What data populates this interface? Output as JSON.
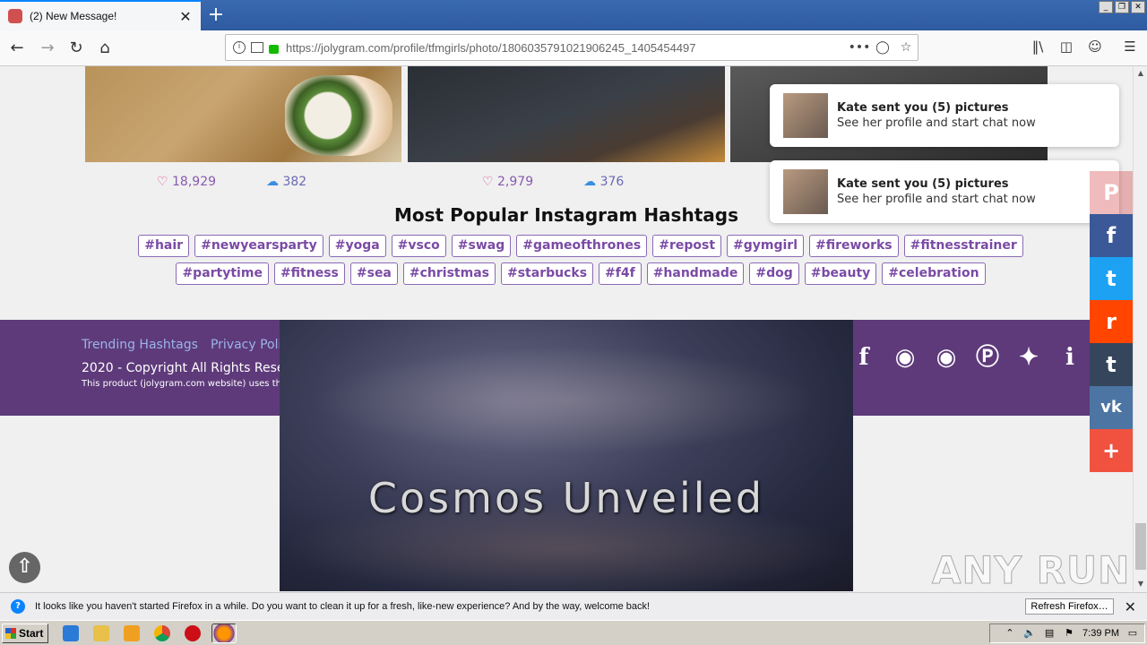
{
  "browser": {
    "tab_title": "(2) New Message!",
    "tab_close": "✕",
    "new_tab": "+",
    "url": "https://jolygram.com/profile/tfmgirls/photo/1806035791021906245_1405454497",
    "url_more": "•••",
    "window_controls": [
      "_",
      "❐",
      "✕"
    ]
  },
  "photos": [
    {
      "likes": "18,929",
      "comments": "382"
    },
    {
      "likes": "2,979",
      "comments": "376"
    }
  ],
  "hashtags": {
    "title": "Most Popular Instagram Hashtags",
    "tags": [
      "#hair",
      "#newyearsparty",
      "#yoga",
      "#vsco",
      "#swag",
      "#gameofthrones",
      "#repost",
      "#gymgirl",
      "#fireworks",
      "#fitnesstrainer",
      "#partytime",
      "#fitness",
      "#sea",
      "#christmas",
      "#starbucks",
      "#f4f",
      "#handmade",
      "#dog",
      "#beauty",
      "#celebration"
    ]
  },
  "footer": {
    "links": [
      "Trending Hashtags",
      "Privacy Polic"
    ],
    "copyright": "2020 - Copyright All Rights Reserv",
    "note": "This product (jolygram.com website) uses the",
    "social_icons": [
      "facebook-icon",
      "instagram-icon",
      "instagram-icon",
      "pinterest-icon",
      "twitter-icon",
      "info-icon"
    ]
  },
  "video_ad": {
    "title": "Cosmos Unveiled"
  },
  "notifications": [
    {
      "title": "Kate sent you (5) pictures",
      "subtitle": "See her profile and start chat now"
    },
    {
      "title": "Kate sent you (5) pictures",
      "subtitle": "See her profile and start chat now"
    }
  ],
  "share_bar": [
    {
      "icon": "pinterest-icon",
      "glyph": "P",
      "color": "#cb2027"
    },
    {
      "icon": "facebook-icon",
      "glyph": "f",
      "color": "#3b5998"
    },
    {
      "icon": "twitter-icon",
      "glyph": "t",
      "color": "#1da1f2"
    },
    {
      "icon": "reddit-icon",
      "glyph": "r",
      "color": "#ff4500"
    },
    {
      "icon": "tumblr-icon",
      "glyph": "t",
      "color": "#35465c"
    },
    {
      "icon": "vk-icon",
      "glyph": "vk",
      "color": "#4c75a3"
    },
    {
      "icon": "more-icon",
      "glyph": "+",
      "color": "#f0523f"
    }
  ],
  "watermark": "ANY RUN",
  "infobar": {
    "text": "It looks like you haven't started Firefox in a while. Do you want to clean it up for a fresh, like-new experience? And by the way, welcome back!",
    "button": "Refresh Firefox…",
    "close": "✕"
  },
  "taskbar": {
    "start": "Start",
    "time": "7:39 PM"
  }
}
